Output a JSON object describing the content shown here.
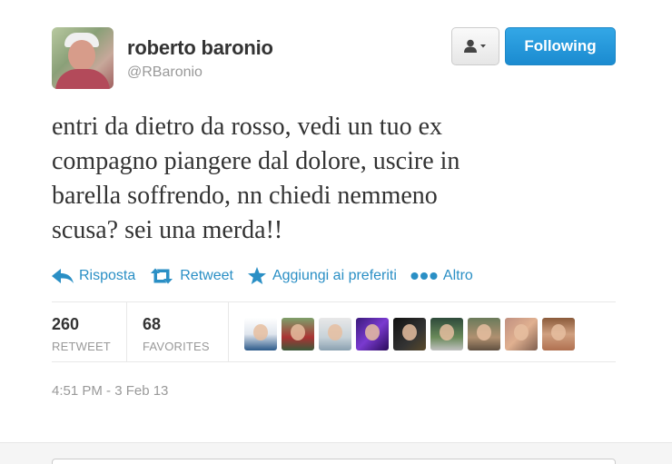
{
  "user": {
    "name": "roberto baronio",
    "handle": "@RBaronio"
  },
  "buttons": {
    "follow_label": "Following"
  },
  "tweet": {
    "lines": [
      "entri da dietro da rosso, vedi un tuo ex",
      "compagno piangere dal dolore, uscire in",
      "barella soffrendo, nn chiedi nemmeno",
      "scusa? sei una merda!!"
    ]
  },
  "actions": {
    "reply": "Risposta",
    "retweet": "Retweet",
    "favorite": "Aggiungi ai preferiti",
    "more": "Altro"
  },
  "stats": {
    "retweets": "260",
    "retweets_label": "RETWEET",
    "favorites": "68",
    "favorites_label": "FAVORITES"
  },
  "timestamp": "4:51 PM - 3 Feb 13",
  "colors": {
    "link": "#2a8fc5",
    "follow_button": "#1b8bd0"
  },
  "icons": [
    "person-dropdown-icon",
    "reply-arrow-icon",
    "retweet-icon",
    "star-icon",
    "more-dots-icon"
  ]
}
